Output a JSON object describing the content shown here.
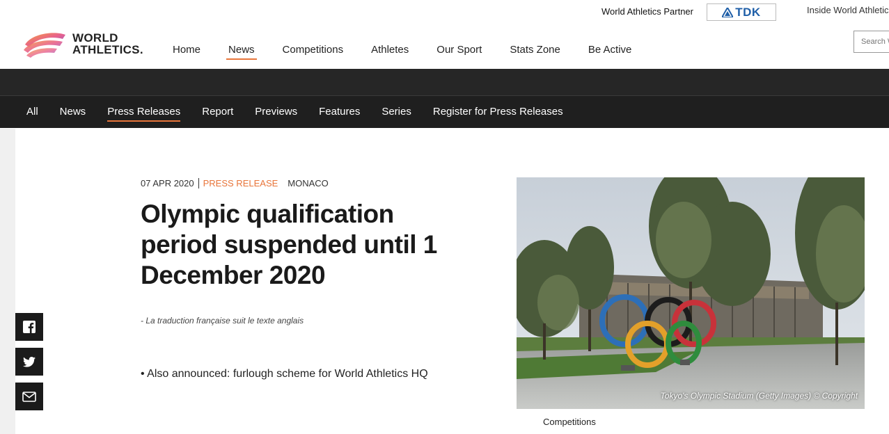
{
  "partner": {
    "label": "World Athletics Partner",
    "sponsor_name": "TDK",
    "inside_link": "Inside World Athletics"
  },
  "logo": {
    "line1": "WORLD",
    "line2": "ATHLETICS."
  },
  "main_nav": [
    {
      "label": "Home",
      "active": false
    },
    {
      "label": "News",
      "active": true
    },
    {
      "label": "Competitions",
      "active": false
    },
    {
      "label": "Athletes",
      "active": false
    },
    {
      "label": "Our Sport",
      "active": false
    },
    {
      "label": "Stats Zone",
      "active": false
    },
    {
      "label": "Be Active",
      "active": false
    }
  ],
  "search": {
    "placeholder": "Search World Athletics"
  },
  "sub_nav": [
    {
      "label": "All",
      "active": false
    },
    {
      "label": "News",
      "active": false
    },
    {
      "label": "Press Releases",
      "active": true
    },
    {
      "label": "Report",
      "active": false
    },
    {
      "label": "Previews",
      "active": false
    },
    {
      "label": "Features",
      "active": false
    },
    {
      "label": "Series",
      "active": false
    },
    {
      "label": "Register for Press Releases",
      "active": false
    }
  ],
  "share": {
    "icons": [
      "facebook-icon",
      "twitter-icon",
      "email-icon"
    ]
  },
  "article": {
    "date": "07 APR 2020",
    "type": "PRESS RELEASE",
    "location": "MONACO",
    "headline": "Olympic qualification period suspended until 1 December 2020",
    "translation_note": "- La traduction française suit le texte anglais",
    "bullet": "• Also announced: furlough scheme for World Athletics HQ"
  },
  "image": {
    "caption": "Tokyo's Olympic Stadium (Getty Images) © Copyright"
  },
  "category": "Competitions",
  "colors": {
    "accent": "#e8753a",
    "dark_bar": "#1f1f1f",
    "tdk_blue": "#1f5fa8"
  }
}
